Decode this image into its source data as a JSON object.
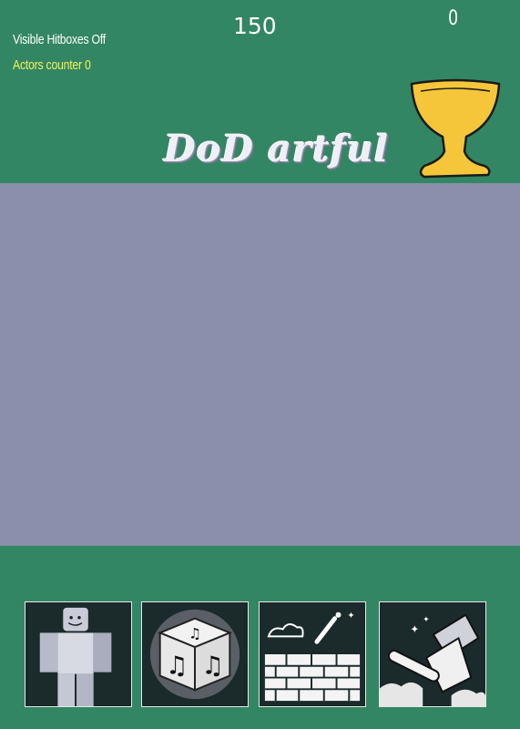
{
  "hud": {
    "hitboxes_label": "Visible Hitboxes Off",
    "actors_label": "Actors counter 0",
    "score": "150",
    "coins": "0"
  },
  "title": "DoD artful",
  "toolbar": {
    "items": [
      {
        "icon": "roblox-character-icon"
      },
      {
        "icon": "music-dice-icon"
      },
      {
        "icon": "brick-wall-icon"
      },
      {
        "icon": "hammer-smash-icon"
      }
    ]
  },
  "colors": {
    "bar_green": "#338663",
    "play_area": "#8a90ac",
    "actors_yellow": "#f2f25a",
    "trophy_gold": "#f5c63a",
    "tile_dark": "#1b2a2b"
  }
}
